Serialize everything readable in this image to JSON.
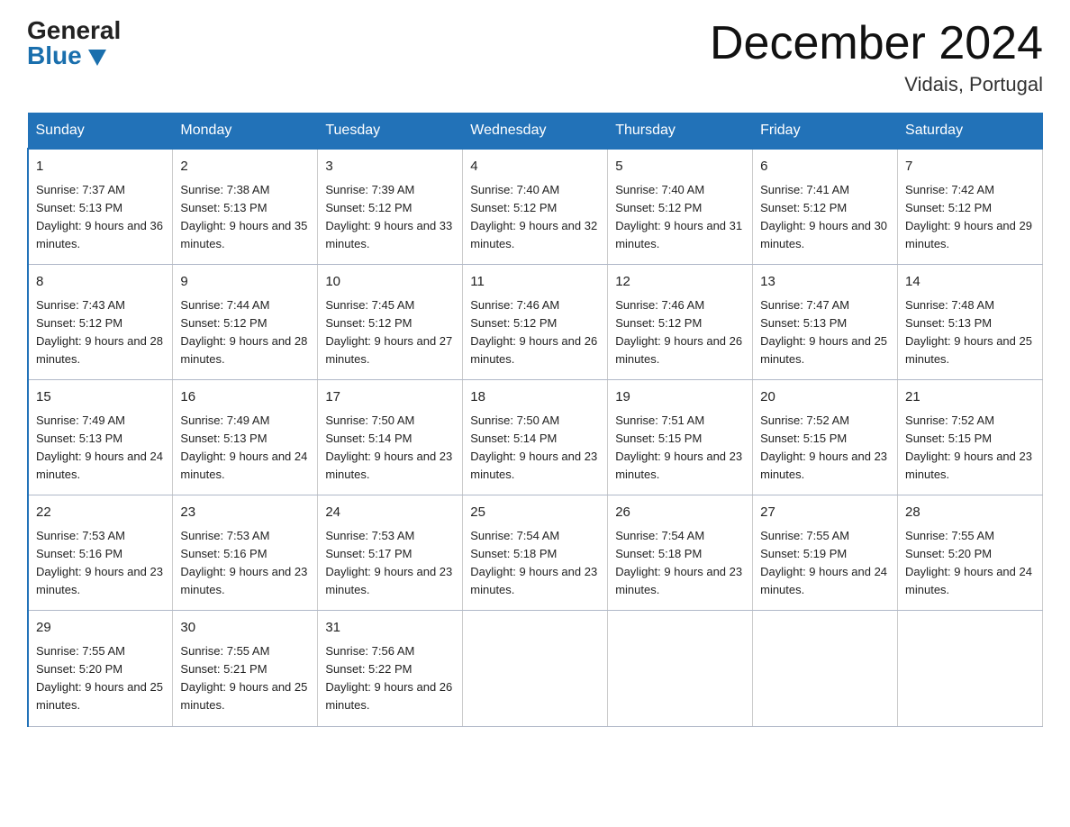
{
  "header": {
    "logo_general": "General",
    "logo_blue": "Blue",
    "month_title": "December 2024",
    "location": "Vidais, Portugal"
  },
  "days_of_week": [
    "Sunday",
    "Monday",
    "Tuesday",
    "Wednesday",
    "Thursday",
    "Friday",
    "Saturday"
  ],
  "weeks": [
    [
      {
        "day": "1",
        "sunrise": "7:37 AM",
        "sunset": "5:13 PM",
        "daylight": "9 hours and 36 minutes."
      },
      {
        "day": "2",
        "sunrise": "7:38 AM",
        "sunset": "5:13 PM",
        "daylight": "9 hours and 35 minutes."
      },
      {
        "day": "3",
        "sunrise": "7:39 AM",
        "sunset": "5:12 PM",
        "daylight": "9 hours and 33 minutes."
      },
      {
        "day": "4",
        "sunrise": "7:40 AM",
        "sunset": "5:12 PM",
        "daylight": "9 hours and 32 minutes."
      },
      {
        "day": "5",
        "sunrise": "7:40 AM",
        "sunset": "5:12 PM",
        "daylight": "9 hours and 31 minutes."
      },
      {
        "day": "6",
        "sunrise": "7:41 AM",
        "sunset": "5:12 PM",
        "daylight": "9 hours and 30 minutes."
      },
      {
        "day": "7",
        "sunrise": "7:42 AM",
        "sunset": "5:12 PM",
        "daylight": "9 hours and 29 minutes."
      }
    ],
    [
      {
        "day": "8",
        "sunrise": "7:43 AM",
        "sunset": "5:12 PM",
        "daylight": "9 hours and 28 minutes."
      },
      {
        "day": "9",
        "sunrise": "7:44 AM",
        "sunset": "5:12 PM",
        "daylight": "9 hours and 28 minutes."
      },
      {
        "day": "10",
        "sunrise": "7:45 AM",
        "sunset": "5:12 PM",
        "daylight": "9 hours and 27 minutes."
      },
      {
        "day": "11",
        "sunrise": "7:46 AM",
        "sunset": "5:12 PM",
        "daylight": "9 hours and 26 minutes."
      },
      {
        "day": "12",
        "sunrise": "7:46 AM",
        "sunset": "5:12 PM",
        "daylight": "9 hours and 26 minutes."
      },
      {
        "day": "13",
        "sunrise": "7:47 AM",
        "sunset": "5:13 PM",
        "daylight": "9 hours and 25 minutes."
      },
      {
        "day": "14",
        "sunrise": "7:48 AM",
        "sunset": "5:13 PM",
        "daylight": "9 hours and 25 minutes."
      }
    ],
    [
      {
        "day": "15",
        "sunrise": "7:49 AM",
        "sunset": "5:13 PM",
        "daylight": "9 hours and 24 minutes."
      },
      {
        "day": "16",
        "sunrise": "7:49 AM",
        "sunset": "5:13 PM",
        "daylight": "9 hours and 24 minutes."
      },
      {
        "day": "17",
        "sunrise": "7:50 AM",
        "sunset": "5:14 PM",
        "daylight": "9 hours and 23 minutes."
      },
      {
        "day": "18",
        "sunrise": "7:50 AM",
        "sunset": "5:14 PM",
        "daylight": "9 hours and 23 minutes."
      },
      {
        "day": "19",
        "sunrise": "7:51 AM",
        "sunset": "5:15 PM",
        "daylight": "9 hours and 23 minutes."
      },
      {
        "day": "20",
        "sunrise": "7:52 AM",
        "sunset": "5:15 PM",
        "daylight": "9 hours and 23 minutes."
      },
      {
        "day": "21",
        "sunrise": "7:52 AM",
        "sunset": "5:15 PM",
        "daylight": "9 hours and 23 minutes."
      }
    ],
    [
      {
        "day": "22",
        "sunrise": "7:53 AM",
        "sunset": "5:16 PM",
        "daylight": "9 hours and 23 minutes."
      },
      {
        "day": "23",
        "sunrise": "7:53 AM",
        "sunset": "5:16 PM",
        "daylight": "9 hours and 23 minutes."
      },
      {
        "day": "24",
        "sunrise": "7:53 AM",
        "sunset": "5:17 PM",
        "daylight": "9 hours and 23 minutes."
      },
      {
        "day": "25",
        "sunrise": "7:54 AM",
        "sunset": "5:18 PM",
        "daylight": "9 hours and 23 minutes."
      },
      {
        "day": "26",
        "sunrise": "7:54 AM",
        "sunset": "5:18 PM",
        "daylight": "9 hours and 23 minutes."
      },
      {
        "day": "27",
        "sunrise": "7:55 AM",
        "sunset": "5:19 PM",
        "daylight": "9 hours and 24 minutes."
      },
      {
        "day": "28",
        "sunrise": "7:55 AM",
        "sunset": "5:20 PM",
        "daylight": "9 hours and 24 minutes."
      }
    ],
    [
      {
        "day": "29",
        "sunrise": "7:55 AM",
        "sunset": "5:20 PM",
        "daylight": "9 hours and 25 minutes."
      },
      {
        "day": "30",
        "sunrise": "7:55 AM",
        "sunset": "5:21 PM",
        "daylight": "9 hours and 25 minutes."
      },
      {
        "day": "31",
        "sunrise": "7:56 AM",
        "sunset": "5:22 PM",
        "daylight": "9 hours and 26 minutes."
      },
      null,
      null,
      null,
      null
    ]
  ],
  "labels": {
    "sunrise": "Sunrise:",
    "sunset": "Sunset:",
    "daylight": "Daylight:"
  }
}
